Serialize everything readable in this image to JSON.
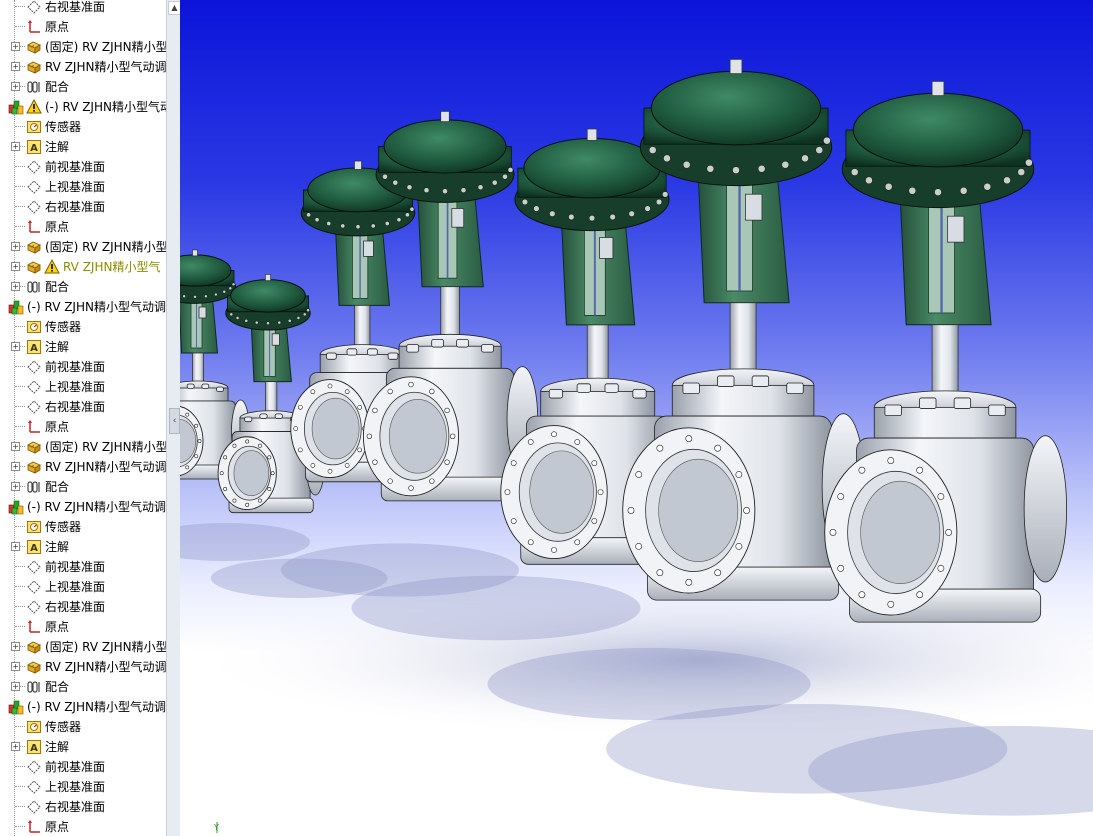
{
  "feature_tree": {
    "rows": [
      {
        "label": "右视基准面",
        "icon": "plane-icon",
        "indent": 1,
        "expander": false
      },
      {
        "label": "原点",
        "icon": "origin-icon",
        "indent": 1,
        "expander": false
      },
      {
        "label": "(固定) RV ZJHN精小型",
        "icon": "part-icon",
        "indent": 1,
        "expander": true
      },
      {
        "label": "RV ZJHN精小型气动调",
        "icon": "part-icon",
        "indent": 1,
        "expander": true
      },
      {
        "label": "配合",
        "icon": "mates-icon",
        "indent": 1,
        "expander": true
      },
      {
        "label": "(-) RV ZJHN精小型气动",
        "icon": "assembly-icon",
        "indent": 0,
        "expander": false,
        "warning": true
      },
      {
        "label": "传感器",
        "icon": "sensor-icon",
        "indent": 1,
        "expander": false
      },
      {
        "label": "注解",
        "icon": "annotation-icon",
        "indent": 1,
        "expander": true
      },
      {
        "label": "前视基准面",
        "icon": "plane-icon",
        "indent": 1,
        "expander": false
      },
      {
        "label": "上视基准面",
        "icon": "plane-icon",
        "indent": 1,
        "expander": false
      },
      {
        "label": "右视基准面",
        "icon": "plane-icon",
        "indent": 1,
        "expander": false
      },
      {
        "label": "原点",
        "icon": "origin-icon",
        "indent": 1,
        "expander": false
      },
      {
        "label": "(固定) RV ZJHN精小型",
        "icon": "part-icon",
        "indent": 1,
        "expander": true
      },
      {
        "label": "RV ZJHN精小型气",
        "icon": "part-icon",
        "indent": 1,
        "expander": true,
        "warning": true
      },
      {
        "label": "配合",
        "icon": "mates-icon",
        "indent": 1,
        "expander": true
      },
      {
        "label": "(-) RV ZJHN精小型气动调",
        "icon": "assembly-icon",
        "indent": 0,
        "expander": false
      },
      {
        "label": "传感器",
        "icon": "sensor-icon",
        "indent": 1,
        "expander": false
      },
      {
        "label": "注解",
        "icon": "annotation-icon",
        "indent": 1,
        "expander": true
      },
      {
        "label": "前视基准面",
        "icon": "plane-icon",
        "indent": 1,
        "expander": false
      },
      {
        "label": "上视基准面",
        "icon": "plane-icon",
        "indent": 1,
        "expander": false
      },
      {
        "label": "右视基准面",
        "icon": "plane-icon",
        "indent": 1,
        "expander": false
      },
      {
        "label": "原点",
        "icon": "origin-icon",
        "indent": 1,
        "expander": false
      },
      {
        "label": "(固定) RV ZJHN精小型",
        "icon": "part-icon",
        "indent": 1,
        "expander": true
      },
      {
        "label": "RV ZJHN精小型气动调",
        "icon": "part-icon",
        "indent": 1,
        "expander": true
      },
      {
        "label": "配合",
        "icon": "mates-icon",
        "indent": 1,
        "expander": true
      },
      {
        "label": "(-) RV ZJHN精小型气动调",
        "icon": "assembly-icon",
        "indent": 0,
        "expander": false
      },
      {
        "label": "传感器",
        "icon": "sensor-icon",
        "indent": 1,
        "expander": false
      },
      {
        "label": "注解",
        "icon": "annotation-icon",
        "indent": 1,
        "expander": true
      },
      {
        "label": "前视基准面",
        "icon": "plane-icon",
        "indent": 1,
        "expander": false
      },
      {
        "label": "上视基准面",
        "icon": "plane-icon",
        "indent": 1,
        "expander": false
      },
      {
        "label": "右视基准面",
        "icon": "plane-icon",
        "indent": 1,
        "expander": false
      },
      {
        "label": "原点",
        "icon": "origin-icon",
        "indent": 1,
        "expander": false
      },
      {
        "label": "(固定) RV ZJHN精小型",
        "icon": "part-icon",
        "indent": 1,
        "expander": true
      },
      {
        "label": "RV ZJHN精小型气动调",
        "icon": "part-icon",
        "indent": 1,
        "expander": true
      },
      {
        "label": "配合",
        "icon": "mates-icon",
        "indent": 1,
        "expander": true
      },
      {
        "label": "(-) RV ZJHN精小型气动调",
        "icon": "assembly-icon",
        "indent": 0,
        "expander": false
      },
      {
        "label": "传感器",
        "icon": "sensor-icon",
        "indent": 1,
        "expander": false
      },
      {
        "label": "注解",
        "icon": "annotation-icon",
        "indent": 1,
        "expander": true
      },
      {
        "label": "前视基准面",
        "icon": "plane-icon",
        "indent": 1,
        "expander": false
      },
      {
        "label": "上视基准面",
        "icon": "plane-icon",
        "indent": 1,
        "expander": false
      },
      {
        "label": "右视基准面",
        "icon": "plane-icon",
        "indent": 1,
        "expander": false
      },
      {
        "label": "原点",
        "icon": "origin-icon",
        "indent": 1,
        "expander": false
      }
    ]
  },
  "viewport": {
    "background_top": "#0b14d9",
    "background_bottom": "#ffffff",
    "actuator_color": "#1f5a3e",
    "yoke_color": "#3d7a58",
    "body_color": "#cfd4dc",
    "triad_label": "Y"
  },
  "colors": {
    "tree_background": "#ffffff",
    "warning_text": "#8c8c00",
    "splitter": "#e7ebf2"
  }
}
